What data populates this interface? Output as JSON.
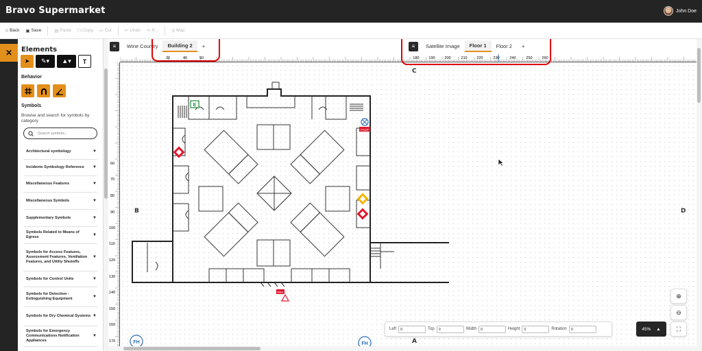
{
  "app": {
    "title": "Bravo Supermarket",
    "user_name": "John Doe"
  },
  "toolbar": {
    "back": "Back",
    "save": "Save",
    "paste": "Paste",
    "copy": "Copy",
    "cut": "Cut",
    "undo": "Undo",
    "redo": "R...",
    "map": "Map"
  },
  "panel": {
    "title": "Elements",
    "behavior_label": "Behavior",
    "symbols_label": "Symbols",
    "symbols_desc": "Browse and search for symbols by category",
    "search_placeholder": "Search symbols...",
    "categories": [
      "Architectural symbology",
      "Incidents Symbology Reference",
      "Miscellaneous Features",
      "Miscellaneous Symbols",
      "Supplementary Symbols",
      "Symbols Related to Means of Egress",
      "Symbols for Access Features, Assessment Features, Ventilation Features, and Utility Shutoffs",
      "Symbols for Control Units",
      "Symbols for Detection - Extinguishing Equipment",
      "Symbols for Dry Chemical Systems",
      "Symbols for Emergency Communications Notification Appliances"
    ]
  },
  "tabs_left": {
    "tabs": [
      "Wine Country",
      "Building 2"
    ],
    "active": "Building 2",
    "add": "+"
  },
  "tabs_right": {
    "tabs": [
      "Satellite Image",
      "Floor 1",
      "Floor 2"
    ],
    "active": "Floor 1",
    "add": "+"
  },
  "rulers": {
    "top_left": [
      "30",
      "40",
      "50"
    ],
    "top_right": [
      "180",
      "190",
      "200",
      "210",
      "220",
      "230",
      "240",
      "250",
      "260"
    ],
    "left": [
      "60",
      "70",
      "80",
      "90",
      "100",
      "110",
      "120",
      "130",
      "140",
      "150",
      "160",
      "170"
    ]
  },
  "compass": {
    "north": "C",
    "south": "A",
    "west": "B",
    "east": "D"
  },
  "plan": {
    "exit_label": "E",
    "facp_label": "FACP",
    "fra_label": "FRA",
    "fh_label": "FH"
  },
  "fields": {
    "left_label": "Left",
    "left_value": "0",
    "top_label": "Top",
    "top_value": "0",
    "width_label": "Width",
    "width_value": "0",
    "height_label": "Height",
    "height_value": "0",
    "rotation_label": "Rotation",
    "rotation_value": "0"
  },
  "zoom": {
    "level": "45%"
  },
  "colors": {
    "accent": "#e38f1b",
    "topbar": "#242424",
    "highlight": "#e00000",
    "hazard_red": "#e0182d",
    "hazard_yellow": "#f5b400",
    "exit_green": "#1a8c3a",
    "fh_blue": "#2a6db5"
  }
}
